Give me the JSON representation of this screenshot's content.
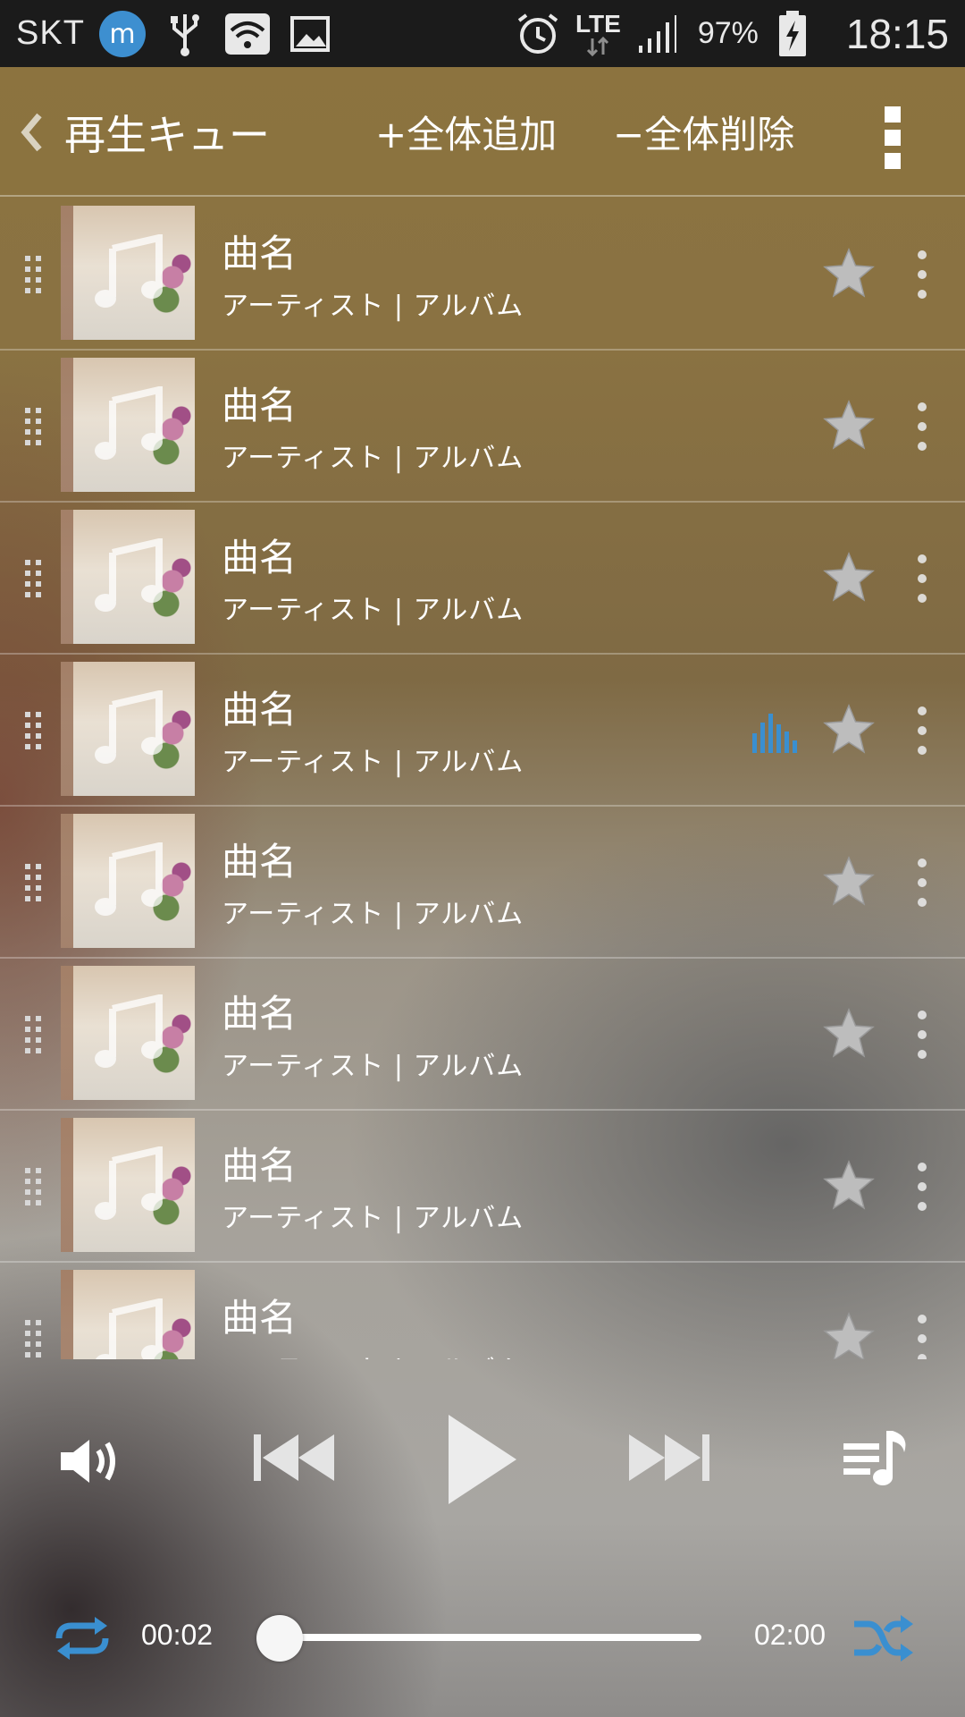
{
  "status_bar": {
    "carrier": "SKT",
    "network": "LTE",
    "battery_percent": "97%",
    "time": "18:15",
    "icons": [
      "m-app-icon",
      "usb-icon",
      "wifi-icon",
      "image-icon",
      "alarm-icon",
      "lte-arrows-icon",
      "signal-icon",
      "battery-charging-icon"
    ]
  },
  "header": {
    "title": "再生キュー",
    "add_all": "+全体追加",
    "remove_all": "−全体削除"
  },
  "queue": [
    {
      "title": "曲名",
      "subtitle": "アーティスト | アルバム",
      "playing": false
    },
    {
      "title": "曲名",
      "subtitle": "アーティスト | アルバム",
      "playing": false
    },
    {
      "title": "曲名",
      "subtitle": "アーティスト | アルバム",
      "playing": false
    },
    {
      "title": "曲名",
      "subtitle": "アーティスト | アルバム",
      "playing": true
    },
    {
      "title": "曲名",
      "subtitle": "アーティスト | アルバム",
      "playing": false
    },
    {
      "title": "曲名",
      "subtitle": "アーティスト | アルバム",
      "playing": false
    },
    {
      "title": "曲名",
      "subtitle": "アーティスト | アルバム",
      "playing": false
    },
    {
      "title": "曲名",
      "subtitle": "アーティスト | アルバム",
      "playing": false
    }
  ],
  "player": {
    "elapsed": "00:02",
    "total": "02:00",
    "progress_fraction": 0.017
  },
  "colors": {
    "accent": "#3a8fd0",
    "header_bg": "#8b7440",
    "status_bar_bg": "#1b1b1b"
  }
}
